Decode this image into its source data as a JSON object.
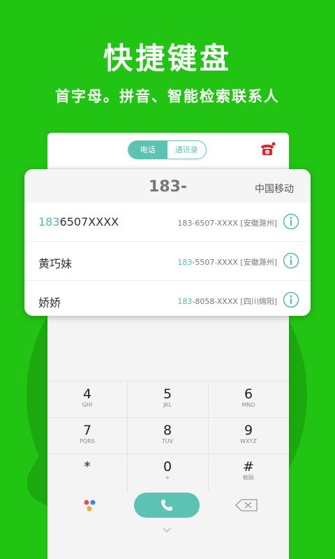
{
  "promo": {
    "title": "快捷键盘",
    "subtitle": "首字母。拼音、智能检索联系人"
  },
  "header": {
    "tabs": [
      {
        "label": "电话",
        "active": true
      },
      {
        "label": "通讯录",
        "active": false
      }
    ]
  },
  "search": {
    "typed_number": "183-",
    "carrier": "中国移动",
    "results": [
      {
        "name_prefix": "183",
        "name_rest": "6507XXXX",
        "detail_prefix": "",
        "detail_rest": "183-6507-XXXX [安徽滁州]"
      },
      {
        "name_prefix": "",
        "name_rest": "黄巧妹",
        "detail_prefix": "183",
        "detail_rest": "-5507-XXXX [安徽滁州]"
      },
      {
        "name_prefix": "",
        "name_rest": "娇娇",
        "detail_prefix": "183",
        "detail_rest": "-8058-XXXX [四川绵阳]"
      }
    ]
  },
  "keypad": {
    "keys": [
      {
        "digit": "4",
        "letters": "GHI"
      },
      {
        "digit": "5",
        "letters": "JKL"
      },
      {
        "digit": "6",
        "letters": "MNO"
      },
      {
        "digit": "7",
        "letters": "PQRS"
      },
      {
        "digit": "8",
        "letters": "TUV"
      },
      {
        "digit": "9",
        "letters": "WXYZ"
      },
      {
        "digit": "*",
        "letters": ""
      },
      {
        "digit": "0",
        "letters": "+"
      },
      {
        "digit": "#",
        "letters": "粘贴"
      }
    ]
  },
  "colors": {
    "background": "#22c414",
    "accent": "#5cc3b2",
    "highlight": "#4dbfa8"
  }
}
